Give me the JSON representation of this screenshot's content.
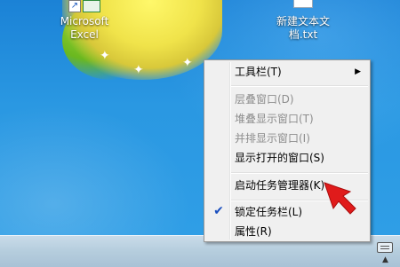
{
  "desktop": {
    "icons": [
      {
        "label": "Microsoft Excel",
        "icon": "excel-icon"
      },
      {
        "label": "新建文本文档.txt",
        "icon": "text-file-icon"
      }
    ]
  },
  "context_menu": {
    "items": [
      {
        "label": "工具栏(T)",
        "enabled": true,
        "submenu": true
      },
      {
        "label": "层叠窗口(D)",
        "enabled": false
      },
      {
        "label": "堆叠显示窗口(T)",
        "enabled": false
      },
      {
        "label": "并排显示窗口(I)",
        "enabled": false
      },
      {
        "label": "显示打开的窗口(S)",
        "enabled": true
      },
      {
        "label": "启动任务管理器(K)",
        "enabled": true
      },
      {
        "label": "锁定任务栏(L)",
        "enabled": true,
        "checked": true
      },
      {
        "label": "属性(R)",
        "enabled": true
      }
    ]
  },
  "taskbar": {
    "tray_icon": "keyboard-icon",
    "tray_chevron_icon": "chevron-up-icon"
  },
  "colors": {
    "desktop_blue": "#2a93df",
    "accent_red": "#e01b1b",
    "checkmark_blue": "#1a4fbf",
    "disabled_text": "#8d8d8d"
  }
}
